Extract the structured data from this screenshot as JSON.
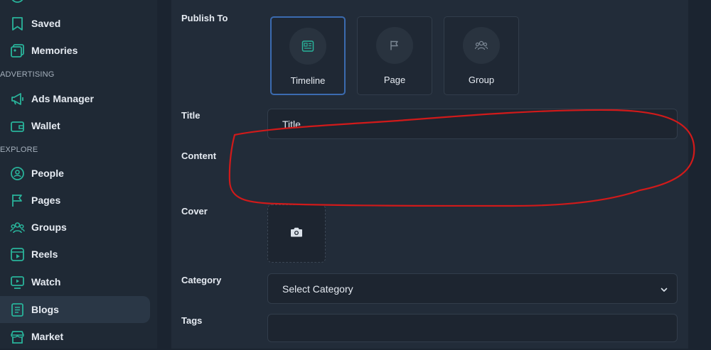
{
  "sidebar": {
    "top_items": [
      {
        "label": "Saved",
        "icon": "bookmark-icon"
      },
      {
        "label": "Memories",
        "icon": "memories-icon"
      }
    ],
    "sections": [
      {
        "title": "ADVERTISING",
        "items": [
          {
            "label": "Ads Manager",
            "icon": "megaphone-icon"
          },
          {
            "label": "Wallet",
            "icon": "wallet-icon"
          }
        ]
      },
      {
        "title": "EXPLORE",
        "items": [
          {
            "label": "People",
            "icon": "people-icon"
          },
          {
            "label": "Pages",
            "icon": "flag-icon"
          },
          {
            "label": "Groups",
            "icon": "groups-icon"
          },
          {
            "label": "Reels",
            "icon": "reels-icon"
          },
          {
            "label": "Watch",
            "icon": "watch-icon"
          },
          {
            "label": "Blogs",
            "icon": "blog-icon",
            "active": true
          },
          {
            "label": "Market",
            "icon": "market-icon"
          }
        ]
      }
    ]
  },
  "form": {
    "publish_to": {
      "label": "Publish To",
      "options": [
        {
          "label": "Timeline",
          "icon": "timeline-icon",
          "selected": true
        },
        {
          "label": "Page",
          "icon": "flag-icon"
        },
        {
          "label": "Group",
          "icon": "group-icon"
        }
      ]
    },
    "title": {
      "label": "Title",
      "value": "Title"
    },
    "content": {
      "label": "Content",
      "value": ""
    },
    "cover": {
      "label": "Cover",
      "icon": "camera-icon"
    },
    "category": {
      "label": "Category",
      "selected": "Select Category"
    },
    "tags": {
      "label": "Tags",
      "value": ""
    }
  },
  "colors": {
    "accent": "#29b39a",
    "selected_border": "#3b6bb0",
    "annotation": "#d11a1a",
    "background": "#222c39"
  }
}
